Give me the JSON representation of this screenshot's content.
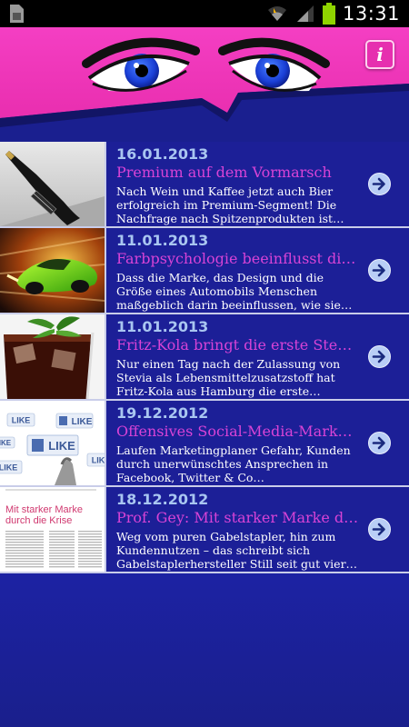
{
  "status": {
    "time": "13:31",
    "icons": [
      "sim-icon",
      "wifi-icon",
      "signal-icon",
      "battery-icon"
    ]
  },
  "header": {
    "info_label": "i"
  },
  "colors": {
    "header_pink": "#f13ec0",
    "navy": "#1a1f8f",
    "title": "#d843d6",
    "date": "#a9c6f1"
  },
  "articles": [
    {
      "date": "16.01.2013",
      "title": "Premium auf dem Vormarsch",
      "text": "Nach Wein und Kaffee jetzt auch Bier erfolgreich im Premium-Segment! Die Nachfrage nach Spitzenprodukten ist…"
    },
    {
      "date": "11.01.2013",
      "title": "Farbpsychologie beeinflusst die…",
      "text": "Dass die Marke, das Design und die Größe eines Automobils Menschen maßgeblich darin beeinflussen, wie sie…"
    },
    {
      "date": "11.01.2013",
      "title": "Fritz-Kola bringt die erste Stevi…",
      "text": "Nur einen Tag nach der Zulassung von Stevia als Lebensmittelzusatzstoff hat Fritz-Kola aus Hamburg die erste…"
    },
    {
      "date": "19.12.2012",
      "title": "Offensives Social-Media-Marketi…",
      "text": "Laufen Marketingplaner Gefahr, Kunden durch unerwünschtes Ansprechen in Facebook, Twitter & Co…"
    },
    {
      "date": "18.12.2012",
      "title": "Prof. Gey: Mit starker Marke dur…",
      "text": "Weg vom puren Gabelstapler, hin zum Kundennutzen – das schreibt sich Gabelstaplerhersteller Still seit gut vier…"
    }
  ],
  "thumbs": {
    "like_label": "LIKE",
    "doc_heading_1": "Mit starker Marke",
    "doc_heading_2": "durch die Krise"
  }
}
